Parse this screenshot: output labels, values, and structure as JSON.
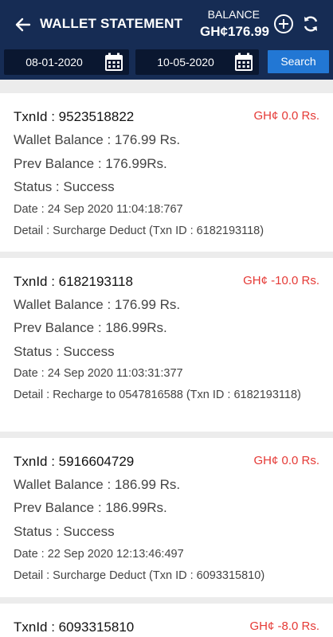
{
  "header": {
    "title": "WALLET STATEMENT",
    "balance_label": "BALANCE",
    "balance_value": "GH¢176.99",
    "back_icon": "arrow-left-icon",
    "add_icon": "plus-circle-icon",
    "refresh_icon": "refresh-icon"
  },
  "filter": {
    "from_date": "08-01-2020",
    "to_date": "10-05-2020",
    "calendar_icon": "calendar-icon",
    "search_label": "Search"
  },
  "colors": {
    "header_bg": "#162c54",
    "date_bg": "#0a1730",
    "search_bg": "#2277d4",
    "amount_color": "#e53935",
    "page_bg": "#ececec"
  },
  "transactions": [
    {
      "txn_id": "TxnId : 9523518822",
      "amount": "GH¢ 0.0 Rs.",
      "wallet_balance": "Wallet Balance : 176.99 Rs.",
      "prev_balance": "Prev Balance : 176.99Rs.",
      "status": "Status : Success",
      "date": "Date : 24 Sep 2020 11:04:18:767",
      "detail": "Detail : Surcharge Deduct (Txn ID : 6182193118)"
    },
    {
      "txn_id": "TxnId : 6182193118",
      "amount": "GH¢ -10.0 Rs.",
      "wallet_balance": "Wallet Balance : 176.99 Rs.",
      "prev_balance": "Prev Balance : 186.99Rs.",
      "status": "Status : Success",
      "date": "Date : 24 Sep 2020 11:03:31:377",
      "detail": "Detail : Recharge to 0547816588 (Txn ID : 6182193118)"
    },
    {
      "txn_id": "TxnId : 5916604729",
      "amount": "GH¢ 0.0 Rs.",
      "wallet_balance": "Wallet Balance : 186.99 Rs.",
      "prev_balance": "Prev Balance : 186.99Rs.",
      "status": "Status : Success",
      "date": "Date : 22 Sep 2020 12:13:46:497",
      "detail": "Detail : Surcharge Deduct (Txn ID : 6093315810)"
    },
    {
      "txn_id": "TxnId : 6093315810",
      "amount": "GH¢ -8.0 Rs."
    }
  ]
}
